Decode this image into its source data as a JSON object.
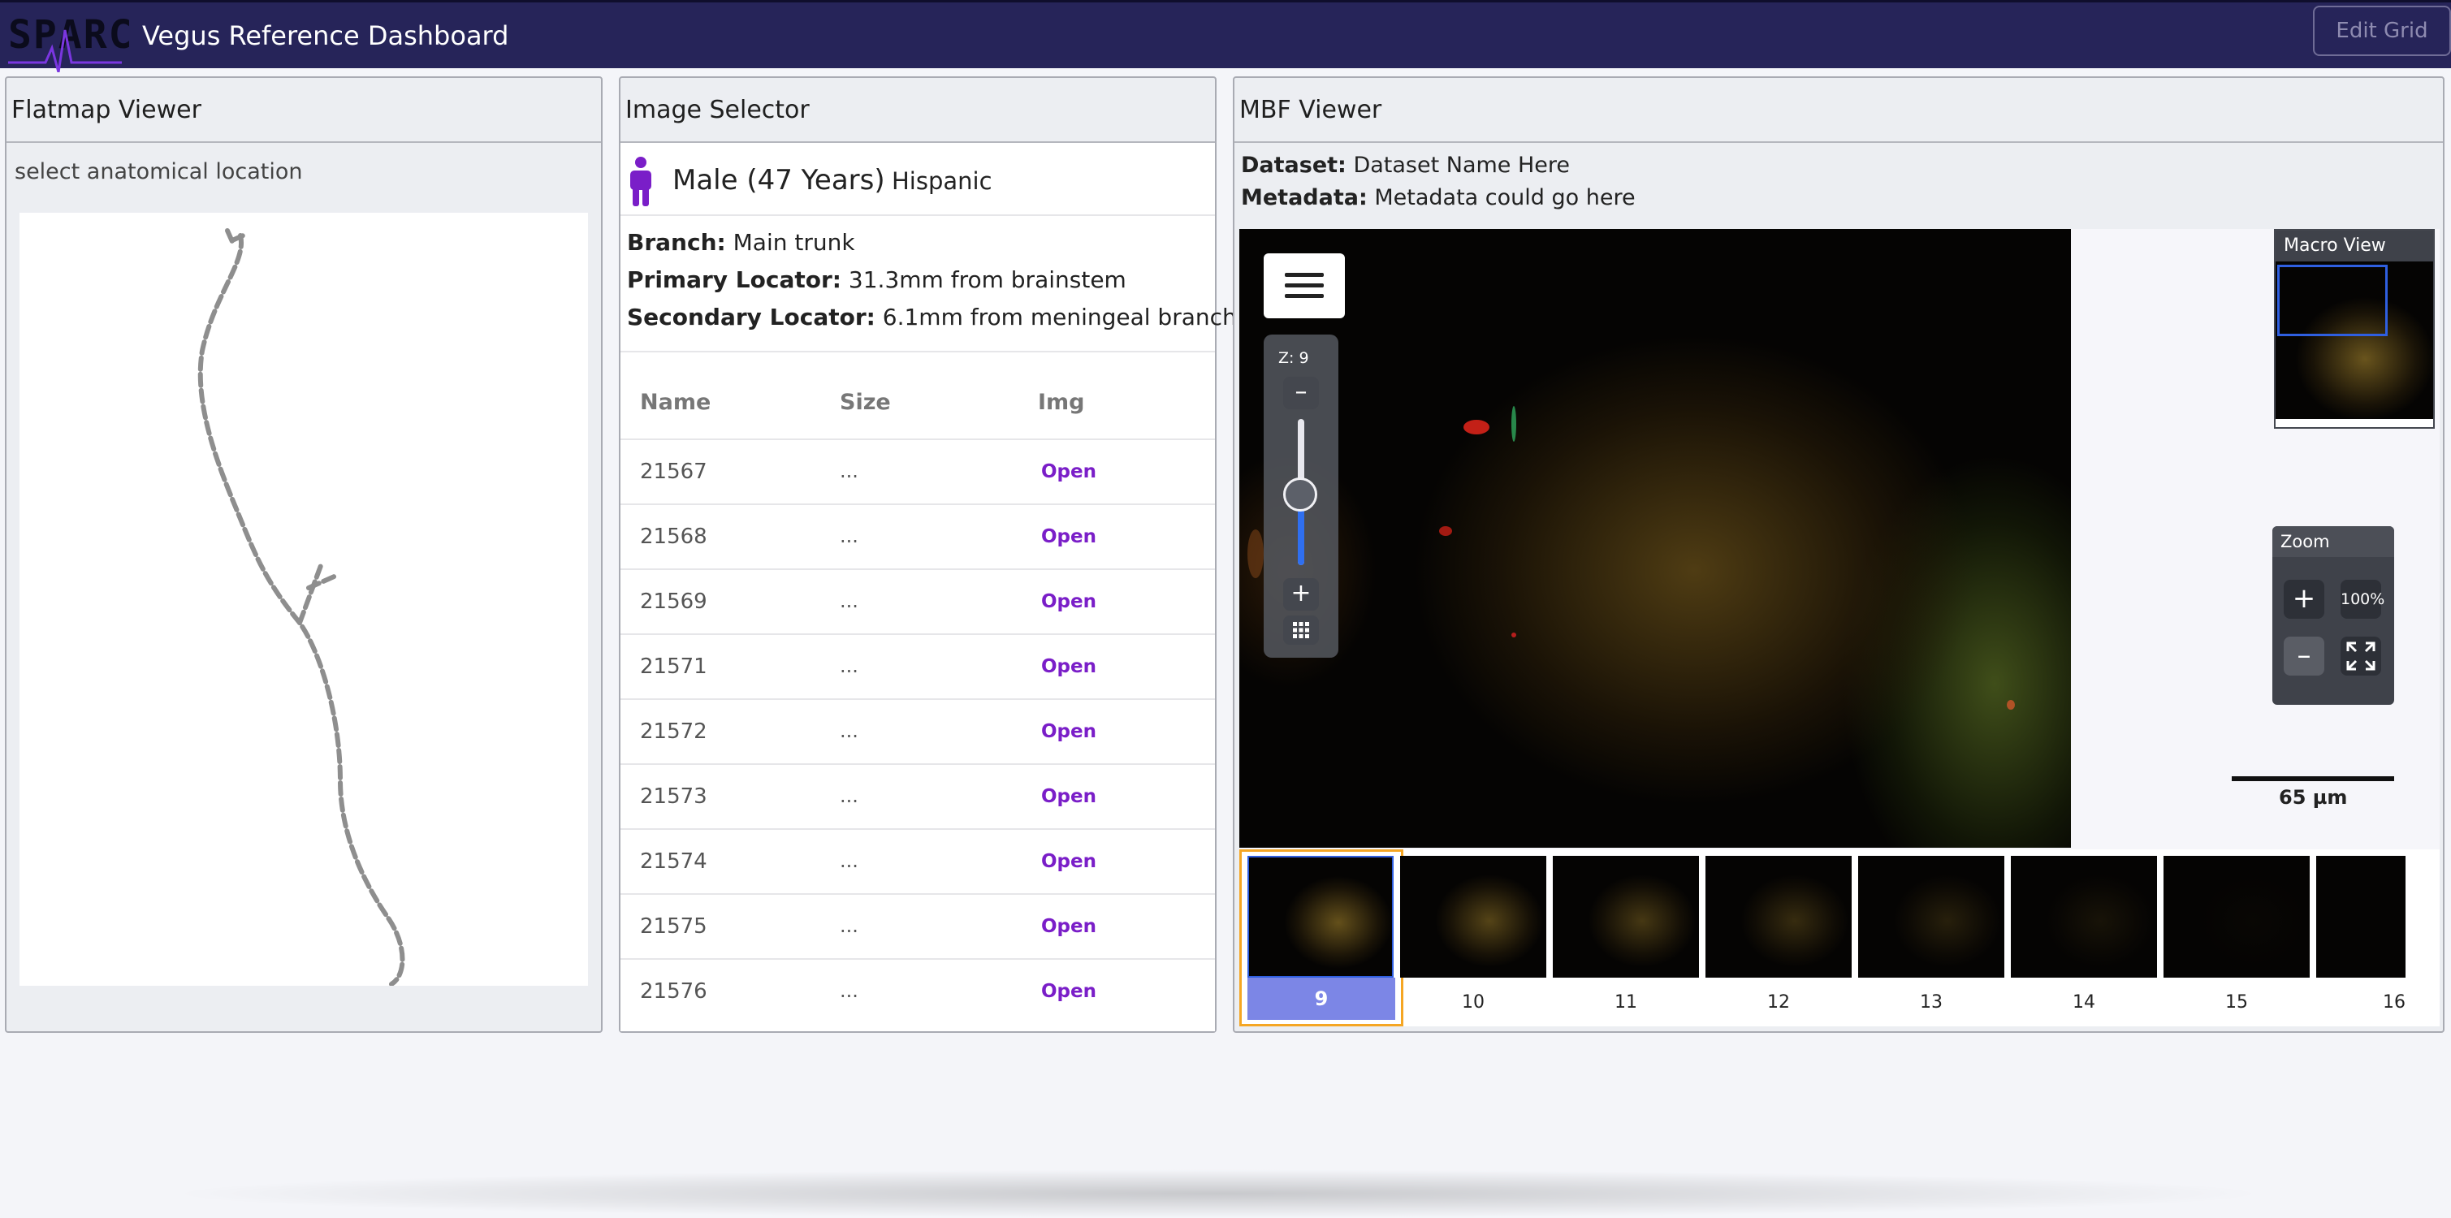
{
  "header": {
    "logo_text": "SPARC",
    "title": "Vegus Reference Dashboard",
    "edit_grid_label": "Edit Grid"
  },
  "flatmap": {
    "title": "Flatmap Viewer",
    "subtitle": "select anatomical location"
  },
  "image_selector": {
    "title": "Image Selector",
    "subject": {
      "sex_age": "Male (47 Years)",
      "ethnicity": "Hispanic",
      "icon": "person-icon"
    },
    "branch_label": "Branch:",
    "branch_value": "Main trunk",
    "primary_label": "Primary Locator:",
    "primary_value": "31.3mm from brainstem",
    "secondary_label": "Secondary Locator:",
    "secondary_value": "6.1mm from meningeal branch",
    "columns": [
      "Name",
      "Size",
      "Img"
    ],
    "rows": [
      {
        "name": "21567",
        "size": "...",
        "img": "Open"
      },
      {
        "name": "21568",
        "size": "...",
        "img": "Open"
      },
      {
        "name": "21569",
        "size": "...",
        "img": "Open"
      },
      {
        "name": "21571",
        "size": "...",
        "img": "Open"
      },
      {
        "name": "21572",
        "size": "...",
        "img": "Open"
      },
      {
        "name": "21573",
        "size": "...",
        "img": "Open"
      },
      {
        "name": "21574",
        "size": "...",
        "img": "Open"
      },
      {
        "name": "21575",
        "size": "...",
        "img": "Open"
      },
      {
        "name": "21576",
        "size": "...",
        "img": "Open"
      }
    ],
    "accent_color": "#7a1ec8"
  },
  "mbf": {
    "title": "MBF Viewer",
    "dataset_label": "Dataset:",
    "dataset_value": "Dataset Name Here",
    "metadata_label": "Metadata:",
    "metadata_value": "Metadata could go here",
    "z_label": "Z: 9",
    "z_level": 9,
    "macro_title": "Macro View",
    "zoom_title": "Zoom",
    "zoom_percent": "100%",
    "scale_label": "65 µm",
    "thumbnails": [
      {
        "label": "9",
        "selected": true
      },
      {
        "label": "10"
      },
      {
        "label": "11"
      },
      {
        "label": "12"
      },
      {
        "label": "13"
      },
      {
        "label": "14"
      },
      {
        "label": "15"
      },
      {
        "label": "16"
      }
    ]
  },
  "colors": {
    "header_bg": "#262459",
    "selected_thumb_label": "#7c86e6",
    "selected_thumb_border": "#f5a623",
    "slider_fill": "#2f6ff0"
  }
}
